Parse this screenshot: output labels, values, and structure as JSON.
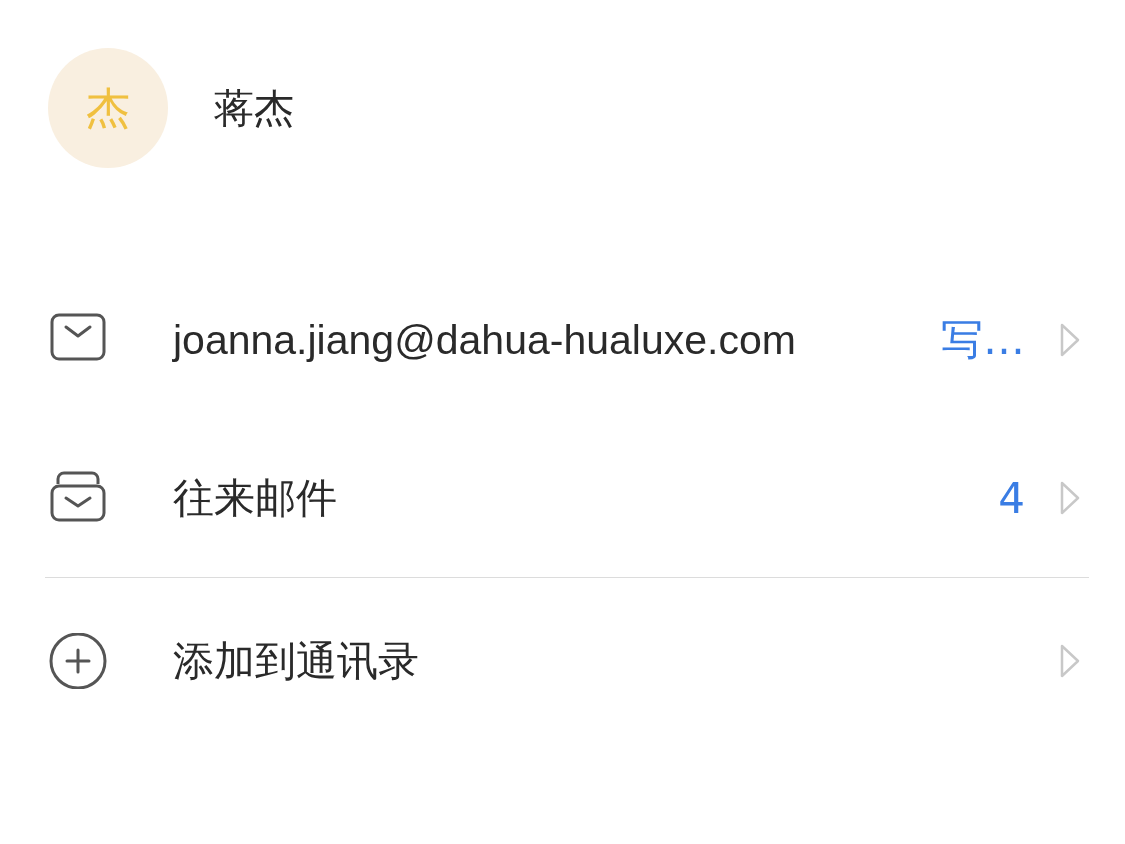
{
  "contact": {
    "avatar_initial": "杰",
    "name": "蒋杰"
  },
  "sections": [
    {
      "rows": [
        {
          "kind": "email",
          "label": "joanna.jiang@dahua-hualuxe.com",
          "action": "写…"
        },
        {
          "kind": "inbox",
          "label": "往来邮件",
          "count": "4"
        }
      ]
    },
    {
      "rows": [
        {
          "kind": "add",
          "label": "添加到通讯录"
        }
      ]
    }
  ]
}
